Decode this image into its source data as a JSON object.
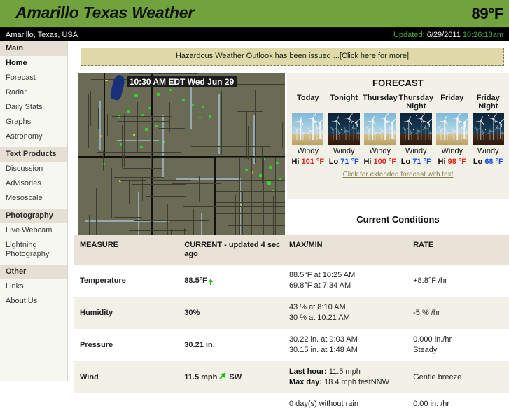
{
  "header": {
    "site_title": "Amarillo Texas Weather",
    "current_temp": "89°F",
    "location": "Amarillo, Texas, USA",
    "updated_label": "Updated:",
    "updated_date": "6/29/2011",
    "updated_time": "10:26:13am",
    "accent_green": "#70a33d",
    "updated_green": "#49a83a"
  },
  "sidebar": {
    "sections": [
      {
        "heading": "Main",
        "items": [
          {
            "label": "Home",
            "active": true
          },
          {
            "label": "Forecast",
            "active": false
          },
          {
            "label": "Radar",
            "active": false
          },
          {
            "label": "Daily Stats",
            "active": false
          },
          {
            "label": "Graphs",
            "active": false
          },
          {
            "label": "Astronomy",
            "active": false
          }
        ]
      },
      {
        "heading": "Text Products",
        "items": [
          {
            "label": "Discussion",
            "active": false
          },
          {
            "label": "Advisories",
            "active": false
          },
          {
            "label": "Mesoscale",
            "active": false
          }
        ]
      },
      {
        "heading": "Photography",
        "items": [
          {
            "label": "Live Webcam",
            "active": false
          },
          {
            "label": "Lightning Photography",
            "active": false
          }
        ]
      },
      {
        "heading": "Other",
        "items": [
          {
            "label": "Links",
            "active": false
          },
          {
            "label": "About Us",
            "active": false
          }
        ]
      }
    ]
  },
  "alert": {
    "text": "Hazardous Weather Outlook has been issued ...[Click here for more]",
    "background": "#dfdaa8"
  },
  "radar": {
    "timestamp": "10:30 AM EDT Wed Jun 29",
    "base_color": "#6a6b55"
  },
  "forecast": {
    "title": "FORECAST",
    "extended_link": "Click for extended forecast with text",
    "hi_color": "#e0211b",
    "lo_color": "#1a4fdb",
    "periods": [
      {
        "day": "Today",
        "night": false,
        "condition": "Windy",
        "temp_label": "Hi",
        "temp": "101",
        "unit": "°F"
      },
      {
        "day": "Tonight",
        "night": true,
        "condition": "Windy",
        "temp_label": "Lo",
        "temp": "71",
        "unit": "°F"
      },
      {
        "day": "Thursday",
        "night": false,
        "condition": "Windy",
        "temp_label": "Hi",
        "temp": "100",
        "unit": "°F"
      },
      {
        "day": "Thursday Night",
        "night": true,
        "condition": "Windy",
        "temp_label": "Lo",
        "temp": "71",
        "unit": "°F"
      },
      {
        "day": "Friday",
        "night": false,
        "condition": "Windy",
        "temp_label": "Hi",
        "temp": "98",
        "unit": "°F"
      },
      {
        "day": "Friday Night",
        "night": true,
        "condition": "Windy",
        "temp_label": "Lo",
        "temp": "68",
        "unit": "°F"
      }
    ]
  },
  "current_conditions": {
    "title": "Current Conditions",
    "columns": {
      "measure": "MEASURE",
      "current": "CURRENT - updated 4 sec ago",
      "maxmin": "MAX/MIN",
      "rate": "RATE"
    },
    "rows": [
      {
        "measure": "Temperature",
        "current": "88.5°F",
        "trend_icon": "arrow-up-icon",
        "max": "88.5°F at 10:25 AM",
        "min": "69.8°F at 7:34 AM",
        "rate1": "+8.8°F /hr",
        "rate2": ""
      },
      {
        "measure": "Humidity",
        "current": "30%",
        "trend_icon": "",
        "max": "43 % at 8:10 AM",
        "min": "30 % at 10:21 AM",
        "rate1": "-5 % /hr",
        "rate2": ""
      },
      {
        "measure": "Pressure",
        "current": "30.21 in.",
        "trend_icon": "",
        "max": "30.22 in. at 9:03 AM",
        "min": "30.15 in. at 1:48 AM",
        "rate1": "0.000 in./hr",
        "rate2": "Steady"
      },
      {
        "measure": "Wind",
        "current": "11.5 mph",
        "trend_icon": "arrow-ne-icon",
        "direction": "SW",
        "max_label": "Last hour:",
        "max": "11.5 mph",
        "min_label": "Max day:",
        "min": "18.4 mph testNNW",
        "rate1": "Gentle breeze",
        "rate2": ""
      },
      {
        "measure": "",
        "current": "",
        "trend_icon": "",
        "max": "0 day(s) without rain",
        "min": "",
        "rate1": "0.00 in. /hr",
        "rate2": ""
      }
    ]
  }
}
